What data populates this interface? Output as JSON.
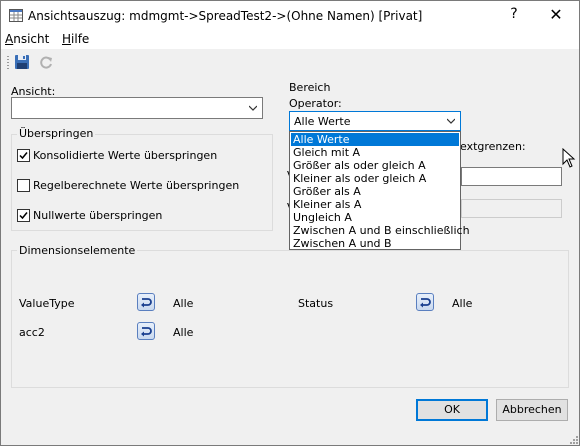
{
  "window": {
    "title": "Ansichtsauszug:  mdmgmt->SpreadTest2->(Ohne Namen)  [Privat]",
    "help_label": "?",
    "close_label": "✕"
  },
  "menu": {
    "items": [
      {
        "label": "Ansicht",
        "hotkey": "A"
      },
      {
        "label": "Hilfe",
        "hotkey": "H"
      }
    ]
  },
  "toolbar": {
    "icons": [
      "save-icon",
      "refresh-icon"
    ]
  },
  "ansicht": {
    "label": "Ansicht:",
    "value": ""
  },
  "ueberspringen": {
    "title": "Überspringen",
    "options": [
      {
        "label": "Konsolidierte Werte überspringen",
        "checked": true
      },
      {
        "label": "Regelberechnete Werte überspringen",
        "checked": false
      },
      {
        "label": "Nullwerte überspringen",
        "checked": true
      }
    ]
  },
  "bereich": {
    "title": "Bereich",
    "operator_label": "Operator:",
    "operator_value": "Alle Werte",
    "partial_label": "extgrenzen:",
    "partial_v1": "V",
    "partial_v2": "V",
    "operator_options": [
      "Alle Werte",
      "Gleich mit A",
      "Größer als oder gleich A",
      "Kleiner als oder gleich A",
      "Größer als A",
      "Kleiner als A",
      "Ungleich A",
      "Zwischen A und B einschließlich",
      "Zwischen A und B"
    ],
    "selected_index": 0
  },
  "dimensionselemente": {
    "title": "Dimensionselemente",
    "items": [
      {
        "name": "ValueType",
        "value": "Alle"
      },
      {
        "name": "Status",
        "value": "Alle"
      },
      {
        "name": "acc2",
        "value": "Alle"
      }
    ]
  },
  "buttons": {
    "ok": "OK",
    "cancel": "Abbrechen"
  },
  "colors": {
    "accent": "#0078d7",
    "window_bg": "#f0f0f0"
  }
}
